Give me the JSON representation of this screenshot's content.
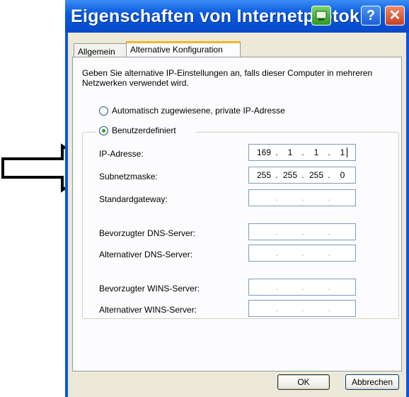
{
  "window": {
    "title": "Eigenschaften von Internetprotok",
    "help_glyph": "?",
    "close_glyph": "✕"
  },
  "tabs": [
    {
      "label": "Allgemein",
      "active": false
    },
    {
      "label": "Alternative Konfiguration",
      "active": true
    }
  ],
  "description": "Geben Sie alternative IP-Einstellungen an, falls dieser Computer in mehreren Netzwerken verwendet wird.",
  "options": {
    "auto_private": {
      "label": "Automatisch zugewiesene, private IP-Adresse",
      "selected": false
    },
    "custom": {
      "label": "Benutzerdefiniert",
      "selected": true
    }
  },
  "fields": {
    "ip_address": {
      "label": "IP-Adresse:",
      "octets": [
        "169",
        "1",
        "1",
        "1"
      ]
    },
    "subnet_mask": {
      "label": "Subnetzmaske:",
      "octets": [
        "255",
        "255",
        "255",
        "0"
      ]
    },
    "default_gateway": {
      "label": "Standardgateway:",
      "octets": [
        "",
        "",
        "",
        ""
      ]
    },
    "preferred_dns": {
      "label": "Bevorzugter DNS-Server:",
      "octets": [
        "",
        "",
        "",
        ""
      ]
    },
    "alternate_dns": {
      "label": "Alternativer DNS-Server:",
      "octets": [
        "",
        "",
        "",
        ""
      ]
    },
    "preferred_wins": {
      "label": "Bevorzugter WINS-Server:",
      "octets": [
        "",
        "",
        "",
        ""
      ]
    },
    "alternate_wins": {
      "label": "Alternativer WINS-Server:",
      "octets": [
        "",
        "",
        "",
        ""
      ]
    }
  },
  "buttons": {
    "ok": "OK",
    "cancel": "Abbrechen"
  },
  "colors": {
    "titlebar": "#0a5be0",
    "dialog_bg": "#ece9d8",
    "panel_bg": "#fcfcfe",
    "tab_highlight": "#f0b630"
  }
}
